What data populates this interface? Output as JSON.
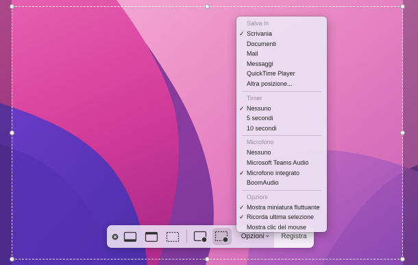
{
  "menu": {
    "sections": [
      {
        "header": "Salva in",
        "items": [
          {
            "label": "Scrivania",
            "checked": true
          },
          {
            "label": "Documenti",
            "checked": false
          },
          {
            "label": "Mail",
            "checked": false
          },
          {
            "label": "Messaggi",
            "checked": false
          },
          {
            "label": "QuickTime Player",
            "checked": false
          },
          {
            "label": "Altra posizione...",
            "checked": false
          }
        ]
      },
      {
        "header": "Timer",
        "items": [
          {
            "label": "Nessuno",
            "checked": true
          },
          {
            "label": "5 secondi",
            "checked": false
          },
          {
            "label": "10 secondi",
            "checked": false
          }
        ]
      },
      {
        "header": "Microfono",
        "items": [
          {
            "label": "Nessuno",
            "checked": false
          },
          {
            "label": "Microsoft Teams Audio",
            "checked": false
          },
          {
            "label": "Microfono integrato",
            "checked": true
          },
          {
            "label": "BoomAudio",
            "checked": false
          }
        ]
      },
      {
        "header": "Opzioni",
        "items": [
          {
            "label": "Mostra miniatura fluttuante",
            "checked": true
          },
          {
            "label": "Ricorda ultima selezione",
            "checked": true
          },
          {
            "label": "Mostra clic del mouse",
            "checked": false
          }
        ]
      }
    ],
    "check_glyph": "✓"
  },
  "toolbar": {
    "close_icon": "close-icon",
    "options_label": "Opzioni",
    "options_chevron": "⌄",
    "record_label": "Registra",
    "active_tool": "record-selected-portion"
  },
  "colors": {
    "selection_border": "#ffffff",
    "toolbar_bg": "#e8daf0",
    "menu_bg": "#ece0f2"
  }
}
